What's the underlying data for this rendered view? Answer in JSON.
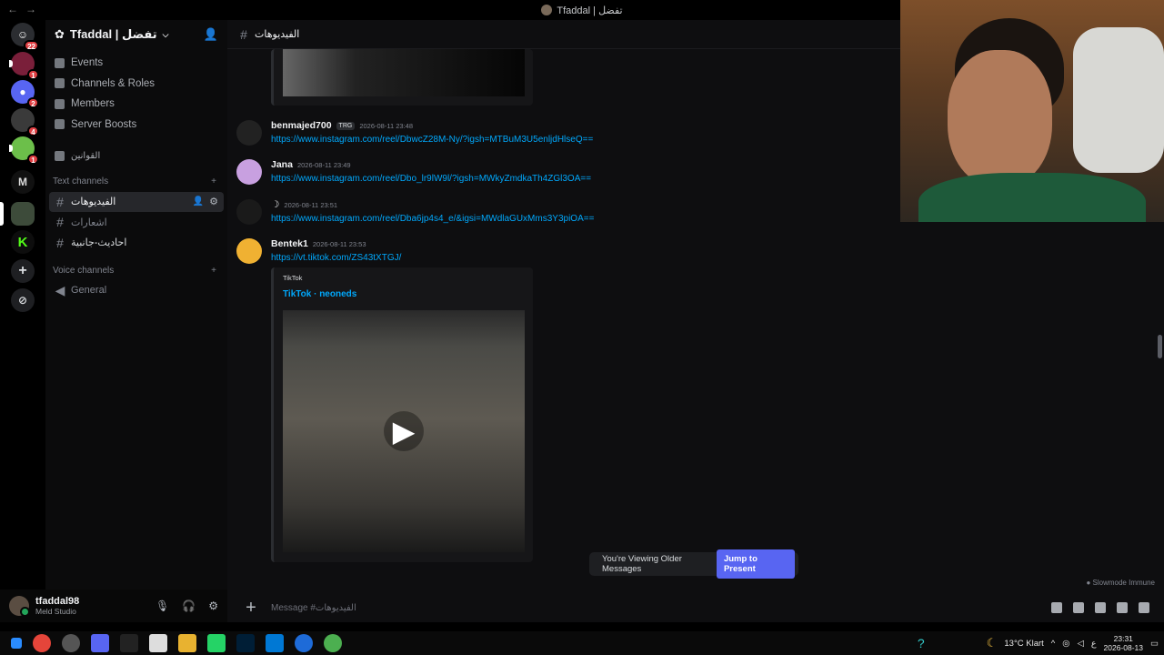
{
  "window": {
    "title": "Tfaddal | تفضل"
  },
  "rail": {
    "servers": [
      {
        "name": "direct-messages",
        "badge": "22"
      },
      {
        "name": "server-1",
        "badge": "1"
      },
      {
        "name": "discord-server",
        "badge": "2"
      },
      {
        "name": "server-3",
        "badge": "4"
      },
      {
        "name": "server-4",
        "badge": "1"
      },
      {
        "name": "server-m",
        "letter": "M"
      },
      {
        "name": "server-tfaddal"
      },
      {
        "name": "server-k",
        "letter": "K"
      }
    ]
  },
  "server": {
    "name": "Tfaddal | تفضل",
    "menu": [
      "Events",
      "Channels & Roles",
      "Members",
      "Server Boosts"
    ],
    "rules_channel": "القوانين",
    "text_category": "Text channels",
    "text_channels": [
      "الفيديوهات",
      "اشعارات",
      "احاديث-جانبية"
    ],
    "voice_category": "Voice channels",
    "voice_channels": [
      "General"
    ]
  },
  "user": {
    "name": "tfaddal98",
    "status": "Meld Studio"
  },
  "channel": {
    "name": "الفيديوهات",
    "composer_placeholder": "Message #الفيديوهات"
  },
  "messages": [
    {
      "author": "benmajed700",
      "tag": "TRG",
      "time": "2026-08-11 23:48",
      "link": "https://www.instagram.com/reel/DbwcZ28M-Ny/?igsh=MTBuM3U5enljdHlseQ=="
    },
    {
      "author": "Jana",
      "time": "2026-08-11 23:49",
      "link": "https://www.instagram.com/reel/Dbo_lr9lW9l/?igsh=MWkyZmdkaTh4ZGl3OA=="
    },
    {
      "author": "☽",
      "time": "2026-08-11 23:51",
      "link": "https://www.instagram.com/reel/Dba6jp4s4_e/&igsi=MWdlaGUxMms3Y3piOA=="
    },
    {
      "author": "Bentek1",
      "time": "2026-08-11 23:53",
      "link": "https://vt.tiktok.com/ZS43tXTGJ/"
    }
  ],
  "embed": {
    "provider": "TikTok",
    "title": "TikTok · neoneds"
  },
  "notice": {
    "text": "You're Viewing Older Messages",
    "button": "Jump to Present"
  },
  "slowmode": "Slowmode Immune",
  "taskbar": {
    "weather": "13°C  Klart",
    "lang": "ع",
    "time": "23:31",
    "date": "2026-08-13"
  }
}
